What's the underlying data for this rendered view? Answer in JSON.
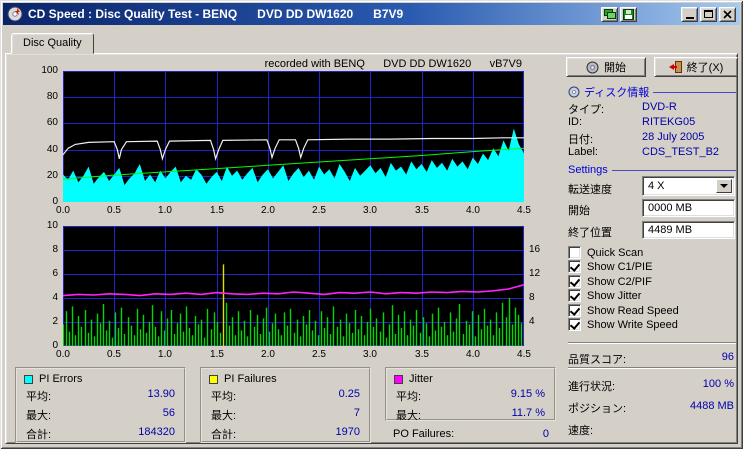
{
  "window": {
    "title": "CD Speed : Disc Quality Test - BENQ      DVD DD DW1620      B7V9"
  },
  "icons": {
    "app": "cd-disc",
    "titlebar_extra_1": "screen-capture",
    "titlebar_extra_2": "save-image",
    "minimize": "minimize-bar",
    "maximize": "maximize-box",
    "close": "close-x",
    "start_button": "disc",
    "exit_button": "exit-door",
    "disc_info": "small-disc",
    "combo": "chevron-down"
  },
  "tab": {
    "label": "Disc Quality"
  },
  "chart_header": "recorded with BENQ      DVD DD DW1620      vB7V9",
  "chart_data": [
    {
      "type": "area",
      "title": "C1/PIE errors with read/write speed curves",
      "x_range": [
        0,
        4.5
      ],
      "y_range": [
        0,
        100
      ],
      "x_ticks": [
        "0.0",
        "0.5",
        "1.0",
        "1.5",
        "2.0",
        "2.5",
        "3.0",
        "3.5",
        "4.0",
        "4.5"
      ],
      "y_ticks": [
        0,
        20,
        40,
        60,
        80,
        100
      ],
      "grid_color": "#2222cc",
      "series": [
        {
          "name": "C1/PIE",
          "type": "area",
          "color": "#00ffff",
          "dx": 0.05,
          "values": [
            21,
            17,
            24,
            15,
            20,
            27,
            14,
            19,
            23,
            16,
            21,
            26,
            13,
            18,
            22,
            29,
            16,
            21,
            15,
            24,
            18,
            23,
            27,
            15,
            20,
            17,
            25,
            21,
            14,
            19,
            23,
            16,
            27,
            20,
            24,
            17,
            22,
            26,
            15,
            21,
            25,
            18,
            23,
            28,
            16,
            22,
            26,
            19,
            24,
            17,
            27,
            21,
            25,
            18,
            29,
            23,
            16,
            26,
            20,
            24,
            28,
            22,
            26,
            19,
            30,
            24,
            27,
            21,
            31,
            25,
            29,
            23,
            32,
            26,
            30,
            24,
            33,
            27,
            31,
            25,
            34,
            29,
            37,
            32,
            41,
            35,
            47,
            39,
            56,
            44,
            37
          ]
        },
        {
          "name": "Read Speed",
          "type": "line",
          "color": "#00ff00",
          "width": 1,
          "points": [
            [
              0,
              17.5
            ],
            [
              0.5,
              20.5
            ],
            [
              1.0,
              23
            ],
            [
              1.5,
              25.5
            ],
            [
              2.0,
              28
            ],
            [
              2.5,
              30.5
            ],
            [
              3.0,
              33
            ],
            [
              3.5,
              35.5
            ],
            [
              4.0,
              38.5
            ],
            [
              4.5,
              41
            ]
          ]
        },
        {
          "name": "Write Speed",
          "type": "line",
          "color": "#f2f2f2",
          "width": 1.2,
          "points": [
            [
              0,
              36
            ],
            [
              0.05,
              41
            ],
            [
              0.12,
              44
            ],
            [
              0.25,
              45.5
            ],
            [
              0.5,
              46
            ],
            [
              0.53,
              40
            ],
            [
              0.55,
              33
            ],
            [
              0.57,
              40
            ],
            [
              0.62,
              46
            ],
            [
              0.92,
              46.5
            ],
            [
              0.95,
              40
            ],
            [
              0.97,
              33
            ],
            [
              1.0,
              40
            ],
            [
              1.04,
              46.5
            ],
            [
              1.44,
              47
            ],
            [
              1.47,
              40
            ],
            [
              1.49,
              33
            ],
            [
              1.52,
              40
            ],
            [
              1.56,
              47
            ],
            [
              1.99,
              47.5
            ],
            [
              2.02,
              41
            ],
            [
              2.04,
              34
            ],
            [
              2.07,
              41
            ],
            [
              2.11,
              47.5
            ],
            [
              2.27,
              47.5
            ],
            [
              2.3,
              41
            ],
            [
              2.32,
              34
            ],
            [
              2.35,
              41
            ],
            [
              2.39,
              47.5
            ],
            [
              2.8,
              48
            ],
            [
              3.2,
              48
            ],
            [
              3.6,
              48.5
            ],
            [
              4.0,
              48.5
            ],
            [
              4.3,
              49
            ],
            [
              4.5,
              49
            ]
          ]
        }
      ]
    },
    {
      "type": "bar",
      "title": "C2/PIF failures with jitter",
      "x_range": [
        0,
        4.5
      ],
      "y_range": [
        0,
        10
      ],
      "x_ticks": [
        "0.0",
        "0.5",
        "1.0",
        "1.5",
        "2.0",
        "2.5",
        "3.0",
        "3.5",
        "4.0",
        "4.5"
      ],
      "y_ticks": [
        0,
        2,
        4,
        6,
        8,
        10
      ],
      "right_axis": {
        "range": [
          0,
          20
        ],
        "ticks": [
          4,
          8,
          12,
          16
        ]
      },
      "grid_color": "#2222cc",
      "series": [
        {
          "name": "C2/PIF",
          "type": "bars",
          "color": "#00d800",
          "spike_color": "#e0e000",
          "spike_min": 5,
          "dx": 0.03,
          "values": [
            1.8,
            2.9,
            1.2,
            3.3,
            0.9,
            2.5,
            1.6,
            3.0,
            1.1,
            2.2,
            0.8,
            2.7,
            1.9,
            3.5,
            1.3,
            2.1,
            0.7,
            2.8,
            1.5,
            3.2,
            1.0,
            2.4,
            1.7,
            0.9,
            3.1,
            1.4,
            2.6,
            1.1,
            2.0,
            3.4,
            1.6,
            0.8,
            2.9,
            1.3,
            2.3,
            3.0,
            1.0,
            1.9,
            2.7,
            1.2,
            3.3,
            1.5,
            0.9,
            2.5,
            1.8,
            2.2,
            0.7,
            3.1,
            1.4,
            2.8,
            2.0,
            1.1,
            6.8,
            3.6,
            1.7,
            2.4,
            0.9,
            2.9,
            1.3,
            2.1,
            0.8,
            3.0,
            1.6,
            2.6,
            1.0,
            2.3,
            3.2,
            1.2,
            1.9,
            2.7,
            1.4,
            0.9,
            2.8,
            1.7,
            3.1,
            1.1,
            2.2,
            0.8,
            2.5,
            1.8,
            3.0,
            1.3,
            2.1,
            0.9,
            2.9,
            1.5,
            2.4,
            1.0,
            3.3,
            1.6,
            2.2,
            0.8,
            2.7,
            1.9,
            1.1,
            3.0,
            1.4,
            2.5,
            0.9,
            2.0,
            3.1,
            1.6,
            2.3,
            1.2,
            2.8,
            0.7,
            1.8,
            3.4,
            1.0,
            2.6,
            1.5,
            2.9,
            0.9,
            2.2,
            1.7,
            3.0,
            1.1,
            2.4,
            1.9,
            0.8,
            2.7,
            1.3,
            3.2,
            1.6,
            2.0,
            0.9,
            2.8,
            1.2,
            2.3,
            3.5,
            1.0,
            2.1,
            1.8,
            2.9,
            0.8,
            2.6,
            1.4,
            3.1,
            1.7,
            2.2,
            0.9,
            2.8,
            1.5,
            3.6,
            2.4,
            4.0,
            1.8,
            3.2,
            2.6,
            1.9
          ]
        },
        {
          "name": "Jitter",
          "type": "line",
          "color": "#ff22ff",
          "width": 1.6,
          "dx": 0.15,
          "values": [
            4.2,
            4.3,
            4.25,
            4.35,
            4.3,
            4.2,
            4.35,
            4.3,
            4.4,
            4.3,
            4.45,
            4.35,
            4.3,
            4.4,
            4.35,
            4.5,
            4.4,
            4.3,
            4.45,
            4.4,
            4.5,
            4.35,
            4.45,
            4.4,
            4.5,
            4.45,
            4.55,
            4.5,
            4.6,
            4.75,
            5.1
          ]
        }
      ]
    }
  ],
  "right_panel": {
    "start_button": "開始",
    "exit_button": "終了(X)",
    "disc_info": {
      "header": "ディスク情報",
      "rows": [
        {
          "label": "タイプ:",
          "value": "DVD-R"
        },
        {
          "label": "ID:",
          "value": "RITEKG05"
        },
        {
          "label": "日付:",
          "value": "28 July 2005"
        },
        {
          "label": "Label:",
          "value": "CDS_TEST_B2"
        }
      ]
    },
    "settings": {
      "header": "Settings",
      "speed_label": "転送速度",
      "speed_value": "4 X",
      "start_label": "開始",
      "start_value": "0000 MB",
      "end_label": "終了位置",
      "end_value": "4489 MB",
      "checkboxes": [
        {
          "label": "Quick Scan",
          "checked": false
        },
        {
          "label": "Show C1/PIE",
          "checked": true
        },
        {
          "label": "Show C2/PIF",
          "checked": true
        },
        {
          "label": "Show Jitter",
          "checked": true
        },
        {
          "label": "Show Read Speed",
          "checked": true
        },
        {
          "label": "Show Write Speed",
          "checked": true
        }
      ]
    },
    "score": {
      "label": "品質スコア:",
      "value": "96"
    },
    "status": [
      {
        "label": "進行状況:",
        "value": "100 %"
      },
      {
        "label": "ポジション:",
        "value": "4488 MB"
      },
      {
        "label": "速度:",
        "value": ""
      }
    ]
  },
  "stats": [
    {
      "title": "PI Errors",
      "color": "#00ffff",
      "rows": [
        {
          "label": "平均:",
          "value": "13.90"
        },
        {
          "label": "最大:",
          "value": "56"
        },
        {
          "label": "合計:",
          "value": "184320"
        }
      ]
    },
    {
      "title": "PI Failures",
      "color": "#ffff00",
      "rows": [
        {
          "label": "平均:",
          "value": "0.25"
        },
        {
          "label": "最大:",
          "value": "7"
        },
        {
          "label": "合計:",
          "value": "1970"
        }
      ]
    },
    {
      "title": "Jitter",
      "color": "#ff00ff",
      "rows": [
        {
          "label": "平均:",
          "value": "9.15 %"
        },
        {
          "label": "最大:",
          "value": "11.7 %"
        }
      ]
    }
  ],
  "po_failures": {
    "label": "PO Failures:",
    "value": "0"
  }
}
